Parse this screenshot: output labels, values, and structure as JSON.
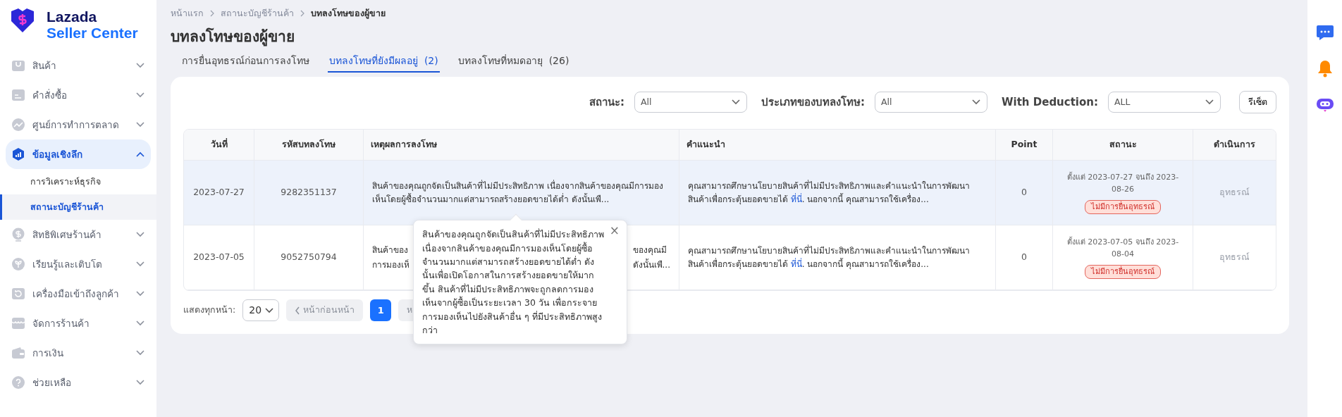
{
  "logo": {
    "line1": "Lazada",
    "line2": "Seller Center"
  },
  "sidebar": {
    "items": [
      {
        "label": "สินค้า",
        "selected": false,
        "expanded": false
      },
      {
        "label": "คำสั่งซื้อ",
        "selected": false,
        "expanded": false
      },
      {
        "label": "ศูนย์การทำการตลาด",
        "selected": false,
        "expanded": false
      },
      {
        "label": "ข้อมูลเชิงลึก",
        "selected": true,
        "expanded": true,
        "children": [
          {
            "label": "การวิเคราะห์ธุรกิจ",
            "selected": false
          },
          {
            "label": "สถานะบัญชีร้านค้า",
            "selected": true
          }
        ]
      },
      {
        "label": "สิทธิพิเศษร้านค้า",
        "selected": false,
        "expanded": false
      },
      {
        "label": "เรียนรู้และเติบโต",
        "selected": false,
        "expanded": false
      },
      {
        "label": "เครื่องมือเข้าถึงลูกค้า",
        "selected": false,
        "expanded": false
      },
      {
        "label": "จัดการร้านค้า",
        "selected": false,
        "expanded": false
      },
      {
        "label": "การเงิน",
        "selected": false,
        "expanded": false
      },
      {
        "label": "ช่วยเหลือ",
        "selected": false,
        "expanded": false
      }
    ]
  },
  "breadcrumb": [
    "หน้าแรก",
    "สถานะบัญชีร้านค้า",
    "บทลงโทษของผู้ขาย"
  ],
  "title": "บทลงโทษของผู้ขาย",
  "tabs": [
    {
      "label": "การยื่นอุทธรณ์ก่อนการลงโทษ",
      "selected": false
    },
    {
      "label": "บทลงโทษที่ยังมีผลอยู่  (2)",
      "selected": true
    },
    {
      "label": "บทลงโทษที่หมดอายุ  (26)",
      "selected": false
    }
  ],
  "filters": [
    {
      "label": "สถานะ:",
      "value": "All"
    },
    {
      "label": "ประเภทของบทลงโทษ:",
      "value": "All"
    },
    {
      "label": "With Deduction:",
      "value": "ALL"
    }
  ],
  "reset_button": "รีเซ็ต",
  "table": {
    "columns": [
      "วันที่",
      "รหัสบทลงโทษ",
      "เหตุผลการลงโทษ",
      "คำแนะนำ",
      "Point",
      "สถานะ",
      "ดำเนินการ"
    ],
    "rows": [
      {
        "date": "2023-07-27",
        "id": "9282351137",
        "reason": "สินค้าของคุณถูกจัดเป็นสินค้าที่ไม่มีประสิทธิภาพ เนื่องจากสินค้าของคุณมีการมองเห็นโดยผู้ซื้อจำนวนมากแต่สามารถสร้างยอดขายได้ต่ำ ดังนั้นเพื...",
        "advice_before": "คุณสามารถศึกษานโยบายสินค้าที่ไม่มีประสิทธิภาพและคำแนะนำในการพัฒนาสินค้าเพื่อกระตุ้นยอดขายได้",
        "advice_link": "ที่นี่",
        "advice_after": ". นอกจากนี้ คุณสามารถใช้เครื่อง...",
        "point": "0",
        "period": "ตั้งแต่ 2023-07-27 จนถึง 2023-08-26",
        "status": "ไม่มีการยื่นอุทธรณ์",
        "action": "อุทธรณ์",
        "action_disabled": true,
        "selected": true
      },
      {
        "date": "2023-07-05",
        "id": "9052750794",
        "reason_visible": [
          {
            "left": "สินค้าของ",
            "right": "ของคุณมี"
          },
          {
            "left": "การมองเห็",
            "right": "ดังนั้นเพื..."
          }
        ],
        "advice_before": "คุณสามารถศึกษานโยบายสินค้าที่ไม่มีประสิทธิภาพและคำแนะนำในการพัฒนาสินค้าเพื่อกระตุ้นยอดขายได้",
        "advice_link": "ที่นี่",
        "advice_after": ". นอกจากนี้ คุณสามารถใช้เครื่อง...",
        "point": "0",
        "period": "ตั้งแต่ 2023-07-05 จนถึง 2023-08-04",
        "status": "ไม่มีการยื่นอุทธรณ์",
        "action": "อุทธรณ์",
        "action_disabled": true,
        "selected": false
      }
    ]
  },
  "tooltip": {
    "text": "สินค้าของคุณถูกจัดเป็นสินค้าที่ไม่มีประสิทธิภาพ เนื่องจากสินค้าของคุณมีการมองเห็นโดยผู้ซื้อจำนวนมากแต่สามารถสร้างยอดขายได้ต่ำ ดังนั้นเพื่อเปิดโอกาสในการสร้างยอดขายให้มากขึ้น สินค้าที่ไม่มีประสิทธิภาพจะถูกลดการมองเห็นจากผู้ซื้อเป็นระยะเวลา 30 วัน เพื่อกระจายการมองเห็นไปยังสินค้าอื่น ๆ ที่มีประสิทธิภาพสูงกว่า",
    "close": "×"
  },
  "pagination": {
    "page_size_label": "แสดงทุกหน้า:",
    "page_size": "20",
    "prev": "หน้าก่อนหน้า",
    "prev_disabled": true,
    "pages": [
      {
        "label": "1",
        "selected": true
      }
    ],
    "next": "ห"
  }
}
